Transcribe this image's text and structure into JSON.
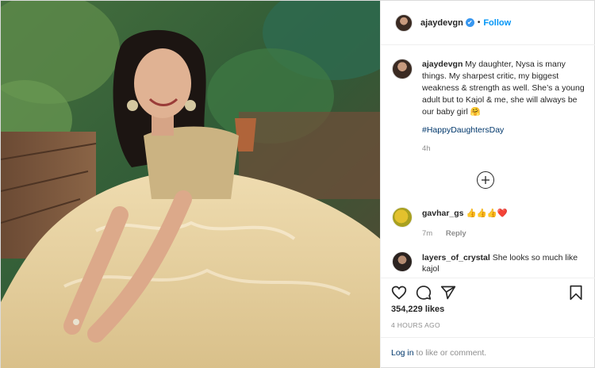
{
  "post": {
    "author": {
      "username": "ajaydevgn",
      "verified_mark": "✔",
      "separator": "•",
      "follow_label": "Follow"
    },
    "caption": {
      "username": "ajaydevgn",
      "text": "My daughter, Nysa is many things. My sharpest critic, my biggest weakness & strength as well. She’s a young adult but to Kajol & me, she will always be our baby girl 🤗",
      "hashtag": "#HappyDaughtersDay",
      "time": "4h"
    },
    "comments": [
      {
        "username": "gavhar_gs",
        "text": "👍👍👍❤️",
        "time": "7m",
        "reply_label": "Reply"
      },
      {
        "username": "layers_of_crystal",
        "text": "She looks so much like kajol"
      }
    ],
    "actions": {
      "like_icon": "heart-icon",
      "comment_icon": "comment-icon",
      "share_icon": "share-icon",
      "save_icon": "bookmark-icon"
    },
    "likes": "354,229 likes",
    "time_ago": "4 HOURS AGO",
    "login": {
      "link": "Log in",
      "rest": " to like or comment."
    },
    "colors": {
      "link_blue": "#0095f6",
      "hashtag_blue": "#00376b",
      "muted": "#8e8e8e",
      "text": "#262626",
      "verified": "#3897f0"
    }
  }
}
